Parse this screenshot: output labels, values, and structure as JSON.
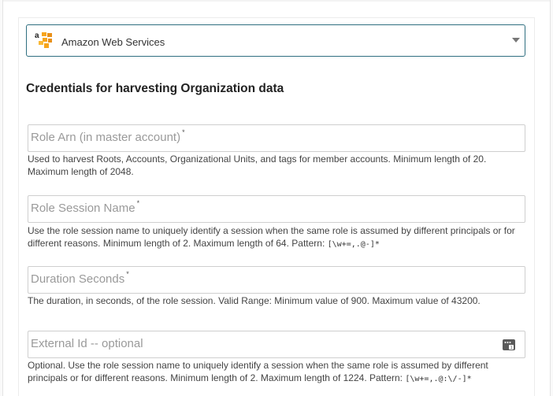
{
  "provider_select": {
    "selected": "Amazon Web Services",
    "logo_icon": "aws-logo-icon",
    "chevron_icon": "chevron-down-icon"
  },
  "section": {
    "title": "Credentials for harvesting Organization data"
  },
  "fields": {
    "role_arn": {
      "placeholder": "Role Arn (in master account)",
      "required_mark": "*",
      "value": "",
      "help": "Used to harvest Roots, Accounts, Organizational Units, and tags for member accounts. Minimum length of 20. Maximum length of 2048."
    },
    "role_session_name": {
      "placeholder": "Role Session Name",
      "required_mark": "*",
      "value": "",
      "help_text": "Use the role session name to uniquely identify a session when the same role is assumed by different principals or for different reasons. Minimum length of 2. Maximum length of 64. Pattern: ",
      "help_pattern": "[\\w+=,.@-]*"
    },
    "duration_seconds": {
      "placeholder": "Duration Seconds",
      "required_mark": "*",
      "value": "",
      "help": "The duration, in seconds, of the role session. Valid Range: Minimum value of 900. Maximum value of 43200."
    },
    "external_id": {
      "placeholder": "External Id -- optional",
      "value": "",
      "icon": "password-manager-icon",
      "help_text": "Optional. Use the role session name to uniquely identify a session when the same role is assumed by different principals or for different reasons. Minimum length of 2. Maximum length of 1224. Pattern: ",
      "help_pattern": "[\\w+=,.@:\\/-]*"
    }
  },
  "colors": {
    "select_border": "#2f6f80",
    "field_border": "#cfcfcf",
    "placeholder": "#9a9a9a",
    "aws_orange": "#f7a51c"
  }
}
